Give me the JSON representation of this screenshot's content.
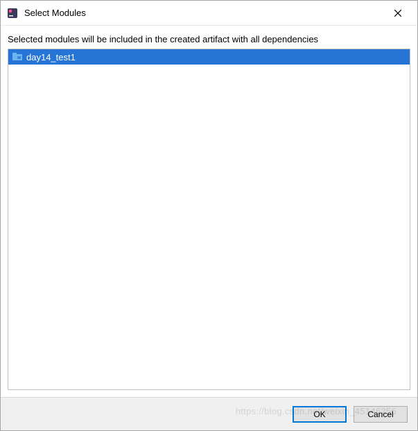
{
  "titlebar": {
    "title": "Select Modules"
  },
  "content": {
    "instruction": "Selected modules will be included in the created artifact with all dependencies"
  },
  "modules": {
    "items": [
      {
        "label": "day14_test1",
        "selected": true
      }
    ]
  },
  "footer": {
    "ok_label": "OK",
    "cancel_label": "Cancel"
  },
  "watermark": "https://blog.csdn.net/weixin_45146256"
}
